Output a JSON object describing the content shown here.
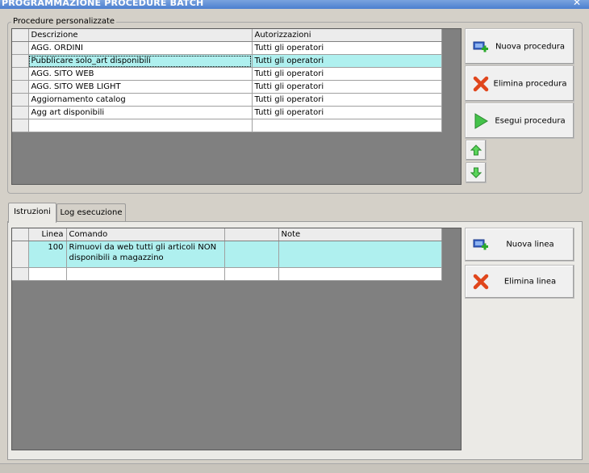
{
  "window": {
    "title": "PROGRAMMAZIONE PROCEDURE BATCH",
    "close_glyph": "✕"
  },
  "procedures": {
    "group_label": "Procedure personalizzate",
    "columns": [
      "Descrizione",
      "Autorizzazioni"
    ],
    "rows": [
      {
        "descrizione": "AGG. ORDINI",
        "autorizzazioni": "Tutti gli operatori"
      },
      {
        "descrizione": "Pubblicare solo_art disponibili",
        "autorizzazioni": "Tutti gli operatori"
      },
      {
        "descrizione": "AGG. SITO WEB",
        "autorizzazioni": "Tutti gli operatori"
      },
      {
        "descrizione": "AGG. SITO WEB LIGHT",
        "autorizzazioni": "Tutti gli operatori"
      },
      {
        "descrizione": "Aggiornamento catalog",
        "autorizzazioni": "Tutti gli operatori"
      },
      {
        "descrizione": "Agg art disponibili",
        "autorizzazioni": "Tutti gli operatori"
      },
      {
        "descrizione": "",
        "autorizzazioni": ""
      }
    ],
    "buttons": {
      "new": "Nuova procedura",
      "delete": "Elimina procedura",
      "run": "Esegui procedura"
    },
    "icons": {
      "new": "new-procedure-icon",
      "delete": "delete-x-icon",
      "run": "play-icon",
      "up": "arrow-up-icon",
      "down": "arrow-down-icon"
    }
  },
  "tabs": [
    {
      "label": "Istruzioni",
      "active": true
    },
    {
      "label": "Log esecuzione",
      "active": false
    }
  ],
  "instructions": {
    "columns": [
      "Linea",
      "Comando",
      "",
      "Note"
    ],
    "rows": [
      {
        "linea": "100",
        "comando_line1": "Rimuovi da web tutti gli articoli NON",
        "comando_line2": "disponibili a magazzino",
        "extra": "",
        "note": ""
      }
    ],
    "buttons": {
      "new": "Nuova linea",
      "delete": "Elimina linea"
    }
  },
  "colors": {
    "selected_row": "#aff0ef",
    "grid_background": "#808080",
    "window_background": "#d4d0c8"
  }
}
